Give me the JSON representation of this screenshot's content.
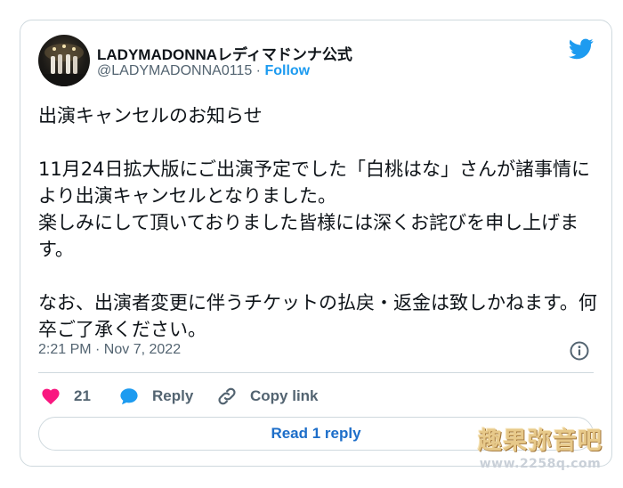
{
  "tweet": {
    "display_name": "LADYMADONNAレディマドンナ公式",
    "handle": "@LADYMADONNA0115",
    "separator": " · ",
    "follow_label": "Follow",
    "text": "出演キャンセルのお知らせ\n\n11月24日拡大版にご出演予定でした「白桃はな」さんが諸事情により出演キャンセルとなりました。\n楽しみにして頂いておりました皆様には深くお詫びを申し上げます。\n\nなお、出演者変更に伴うチケットの払戻・返金は致しかねます。何卒ご了承ください。",
    "timestamp": "2:21 PM · Nov 7, 2022",
    "like_count": "21",
    "reply_label": "Reply",
    "copy_link_label": "Copy link",
    "read_replies_label": "Read 1 reply"
  },
  "watermark": {
    "title": "趣果弥音吧",
    "url": "www.2258q.com"
  },
  "colors": {
    "accent": "#1d9bf0",
    "like": "#f91880",
    "text_secondary": "#536471",
    "border": "#cfd9de"
  },
  "icons": [
    "twitter-bird-icon",
    "info-icon",
    "heart-icon",
    "reply-bubble-icon",
    "link-icon"
  ]
}
